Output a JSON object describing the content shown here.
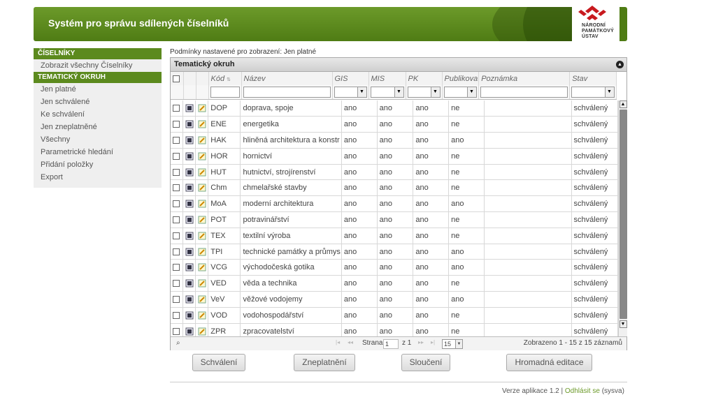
{
  "header": {
    "app_title": "Systém pro správu sdílených číselníků",
    "logo_lines": [
      "NÁRODNÍ",
      "PAMÁTKOVÝ",
      "ÚSTAV"
    ]
  },
  "sidebar": {
    "sections": [
      {
        "title": "ČÍSELNÍKY",
        "items": [
          "Zobrazit všechny Číselníky"
        ]
      },
      {
        "title": "TEMATICKÝ OKRUH",
        "items": [
          "Jen platné",
          "Jen schválené",
          "Ke schválení",
          "Jen zneplatněné",
          "Všechny",
          "Parametrické hledání",
          "Přidání položky",
          "Export"
        ]
      }
    ]
  },
  "conditions_text": "Podmínky nastavené pro zobrazení: Jen platné",
  "grid": {
    "caption": "Tematický okruh",
    "columns": [
      "Kód",
      "Název",
      "GIS",
      "MIS",
      "PK",
      "Publikova",
      "Poznámka",
      "Stav"
    ],
    "rows": [
      [
        "DOP",
        "doprava, spoje",
        "ano",
        "ano",
        "ano",
        "ne",
        "",
        "schválený"
      ],
      [
        "ENE",
        "energetika",
        "ano",
        "ano",
        "ano",
        "ne",
        "",
        "schválený"
      ],
      [
        "HAK",
        "hliněná architektura a konstr",
        "ano",
        "ano",
        "ano",
        "ano",
        "",
        "schválený"
      ],
      [
        "HOR",
        "hornictví",
        "ano",
        "ano",
        "ano",
        "ne",
        "",
        "schválený"
      ],
      [
        "HUT",
        "hutnictví, strojírenství",
        "ano",
        "ano",
        "ano",
        "ne",
        "",
        "schválený"
      ],
      [
        "Chm",
        "chmelařské stavby",
        "ano",
        "ano",
        "ano",
        "ne",
        "",
        "schválený"
      ],
      [
        "MoA",
        "moderní architektura",
        "ano",
        "ano",
        "ano",
        "ano",
        "",
        "schválený"
      ],
      [
        "POT",
        "potravinářství",
        "ano",
        "ano",
        "ano",
        "ne",
        "",
        "schválený"
      ],
      [
        "TEX",
        "textilní výroba",
        "ano",
        "ano",
        "ano",
        "ne",
        "",
        "schválený"
      ],
      [
        "TPI",
        "technické památky a průmys",
        "ano",
        "ano",
        "ano",
        "ano",
        "",
        "schválený"
      ],
      [
        "VCG",
        "východočeská gotika",
        "ano",
        "ano",
        "ano",
        "ano",
        "",
        "schválený"
      ],
      [
        "VED",
        "věda a technika",
        "ano",
        "ano",
        "ano",
        "ne",
        "",
        "schválený"
      ],
      [
        "VeV",
        "věžové vodojemy",
        "ano",
        "ano",
        "ano",
        "ano",
        "",
        "schválený"
      ],
      [
        "VOD",
        "vodohospodářství",
        "ano",
        "ano",
        "ano",
        "ne",
        "",
        "schválený"
      ],
      [
        "ZPR",
        "zpracovatelství",
        "ano",
        "ano",
        "ano",
        "ne",
        "",
        "schválený"
      ]
    ],
    "pager": {
      "page_label": "Strana",
      "page_value": "1",
      "of_label": "z 1",
      "page_size": "15",
      "summary": "Zobrazeno 1 - 15 z 15 záznamů"
    }
  },
  "actions": {
    "approve": "Schválení",
    "invalidate": "Zneplatnění",
    "merge": "Sloučení",
    "bulk_edit": "Hromadná editace"
  },
  "footer": {
    "version_text": "Verze aplikace 1.2 |",
    "logout": "Odhlásit se",
    "user": "(sysva)"
  },
  "colors": {
    "brand_green": "#5c8a1e",
    "link_green": "#6c9a2a"
  }
}
